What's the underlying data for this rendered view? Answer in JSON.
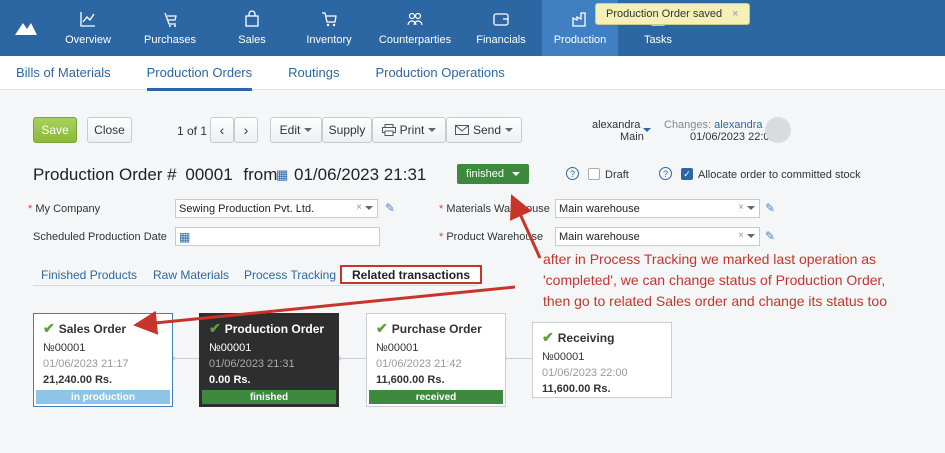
{
  "nav": {
    "items": [
      {
        "label": "Overview",
        "icon": "chart-icon"
      },
      {
        "label": "Purchases",
        "icon": "purchases-icon"
      },
      {
        "label": "Sales",
        "icon": "bag-icon"
      },
      {
        "label": "Inventory",
        "icon": "cart-icon"
      },
      {
        "label": "Counterparties",
        "icon": "people-icon"
      },
      {
        "label": "Financials",
        "icon": "wallet-icon"
      },
      {
        "label": "Production",
        "icon": "factory-icon"
      },
      {
        "label": "Tasks",
        "icon": "tasks-icon"
      }
    ],
    "active": "Production"
  },
  "toast": {
    "text": "Production Order saved",
    "close": "×"
  },
  "subnav": {
    "tabs": [
      "Bills of Materials",
      "Production Orders",
      "Routings",
      "Production Operations"
    ],
    "active": "Production Orders"
  },
  "toolbar": {
    "save": "Save",
    "close": "Close",
    "pager": "1 of 1",
    "edit": "Edit",
    "supply": "Supply",
    "print": "Print",
    "send": "Send"
  },
  "owner": {
    "name": "alexandra",
    "dept": "Main"
  },
  "changes": {
    "label": "Changes:",
    "user": "alexandra",
    "date": "01/06/2023 22:04"
  },
  "order": {
    "title": "Production Order #",
    "number": "00001",
    "from": "from",
    "datetime": "01/06/2023 21:31",
    "status": "finished",
    "draft_label": "Draft",
    "allocate_label": "Allocate order to committed stock"
  },
  "form": {
    "company_label": "My Company",
    "company_value": "Sewing Production Pvt. Ltd.",
    "scheduled_label": "Scheduled Production Date",
    "materials_label": "Materials Warehouse",
    "materials_value": "Main warehouse",
    "product_label": "Product Warehouse",
    "product_value": "Main warehouse"
  },
  "doc_tabs": [
    "Finished Products",
    "Raw Materials",
    "Process Tracking",
    "Related transactions"
  ],
  "cards": [
    {
      "title": "Sales Order",
      "num": "№00001",
      "date": "01/06/2023 21:17",
      "amount": "21,240.00 Rs.",
      "status": "in production",
      "status_color": "#8ec5e6"
    },
    {
      "title": "Production Order",
      "num": "№00001",
      "date": "01/06/2023 21:31",
      "amount": "0.00 Rs.",
      "status": "finished",
      "status_color": "#3d8a3f"
    },
    {
      "title": "Purchase Order",
      "num": "№00001",
      "date": "01/06/2023 21:42",
      "amount": "11,600.00 Rs.",
      "status": "received",
      "status_color": "#3d8a3f"
    },
    {
      "title": "Receiving",
      "num": "№00001",
      "date": "01/06/2023 22:00",
      "amount": "11,600.00 Rs."
    }
  ],
  "annotation": {
    "line1": "after in Process Tracking we marked last operation as",
    "line2": "'completed', we can change status of Production Order,",
    "line3": "then go to related Sales order and change its status too",
    "color": "#c7352a"
  }
}
